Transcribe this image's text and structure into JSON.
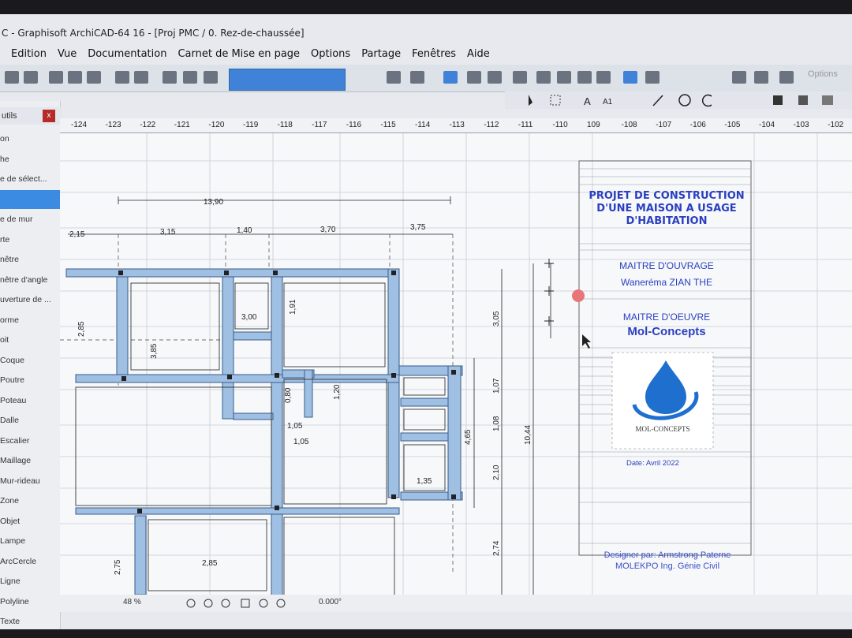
{
  "window": {
    "title": "C - Graphisoft ArchiCAD-64 16 - [Proj PMC / 0. Rez-de-chaussée]"
  },
  "menu": [
    "Edition",
    "Vue",
    "Documentation",
    "Carnet de Mise en page",
    "Options",
    "Partage",
    "Fenêtres",
    "Aide"
  ],
  "toolbar": {
    "options_label": "Options",
    "text_tool_label": "A"
  },
  "sidebar": {
    "header": "utils",
    "items": [
      {
        "label": "on"
      },
      {
        "label": "he"
      },
      {
        "label": "e de sélect..."
      },
      {
        "label": ""
      },
      {
        "label": "e de mur"
      },
      {
        "label": "rte"
      },
      {
        "label": "nêtre"
      },
      {
        "label": "nêtre d'angle"
      },
      {
        "label": "uverture de ..."
      },
      {
        "label": "orme"
      },
      {
        "label": "oit"
      },
      {
        "label": "Coque"
      },
      {
        "label": "Poutre"
      },
      {
        "label": "Poteau"
      },
      {
        "label": "Dalle"
      },
      {
        "label": "Escalier"
      },
      {
        "label": "Maillage"
      },
      {
        "label": "Mur-rideau"
      },
      {
        "label": "Zone"
      },
      {
        "label": "Objet"
      },
      {
        "label": "Lampe"
      },
      {
        "label": "ArcCercle"
      },
      {
        "label": "Ligne"
      },
      {
        "label": "Polyline"
      },
      {
        "label": "Texte"
      }
    ]
  },
  "ruler": {
    "ticks": [
      "-124",
      "-123",
      "-122",
      "-121",
      "-120",
      "-119",
      "-118",
      "-117",
      "-116",
      "-115",
      "-114",
      "-113",
      "-112",
      "-111",
      "-110",
      "109",
      "-108",
      "-107",
      "-106",
      "-105",
      "-104",
      "-103",
      "-102"
    ]
  },
  "plan": {
    "dimensions": {
      "overall": "13,90",
      "segments": [
        "2,15",
        "3,15",
        "1,40",
        "3,70",
        "3,75"
      ],
      "inner": [
        "2,85",
        "3,85",
        "3,00",
        "1,91",
        "0,80",
        "1,20",
        "1,05",
        "1,05",
        "1,35",
        "2,85",
        "2,75"
      ],
      "right_column": [
        "3,05",
        "1,07",
        "1,08",
        "4,65",
        "2,10",
        "10,44",
        "2,74"
      ]
    }
  },
  "title_block": {
    "project_title": "PROJET DE CONSTRUCTION D'UNE MAISON A USAGE D'HABITATION",
    "owner_label": "MAITRE D'OUVRAGE",
    "owner_name": "Waneréma ZIAN THE",
    "contractor_label": "MAITRE D'OEUVRE",
    "contractor_name": "Mol-Concepts",
    "logo_text": "MOL-CONCEPTS",
    "date": "Date: Avril 2022",
    "designer": "Designer par: Armstrong Paterne MOLEKPO Ing. Génie Civil"
  },
  "status": {
    "zoom": "48 %",
    "angle": "0.000°"
  },
  "colors": {
    "wall_fill": "#9fbfe3",
    "wall_edge": "#3a5d8c",
    "title_blue": "#2a3fc0",
    "logo_blue": "#1f6fcf"
  }
}
